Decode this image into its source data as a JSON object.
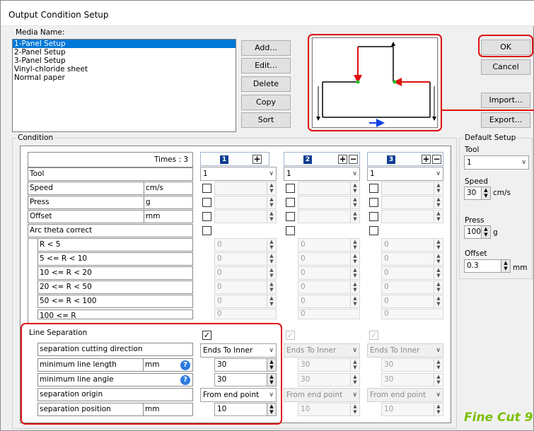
{
  "window": {
    "title": "Output Condition Setup"
  },
  "media": {
    "label": "Media Name:",
    "items": [
      "1-Panel Setup",
      "2-Panel Setup",
      "3-Panel Setup",
      "Vinyl-chloride sheet",
      "Normal paper"
    ],
    "selected_index": 0
  },
  "buttons": {
    "add": "Add...",
    "edit": "Edit...",
    "delete": "Delete",
    "copy": "Copy",
    "sort": "Sort",
    "ok": "OK",
    "cancel": "Cancel",
    "import": "Import...",
    "export": "Export..."
  },
  "condition": {
    "label": "Condition",
    "times_label": "Times : 3",
    "rows": [
      {
        "label": "Tool",
        "unit": ""
      },
      {
        "label": "Speed",
        "unit": "cm/s"
      },
      {
        "label": "Press",
        "unit": "g"
      },
      {
        "label": "Offset",
        "unit": "mm"
      },
      {
        "label": "Arc theta correct",
        "unit": ""
      },
      {
        "label": "R < 5",
        "unit": ""
      },
      {
        "label": "5 <= R < 10",
        "unit": ""
      },
      {
        "label": "10 <= R < 20",
        "unit": ""
      },
      {
        "label": "20 <= R < 50",
        "unit": ""
      },
      {
        "label": "50 <= R < 100",
        "unit": ""
      },
      {
        "label": "100 <= R",
        "unit": ""
      }
    ],
    "line_sep_rows": [
      {
        "label": "Line Separation",
        "unit": ""
      },
      {
        "label": "separation cutting direction",
        "unit": ""
      },
      {
        "label": "minimum line length",
        "unit": "mm"
      },
      {
        "label": "minimum line angle",
        "unit": ""
      },
      {
        "label": "separation origin",
        "unit": ""
      },
      {
        "label": "separation position",
        "unit": "mm"
      }
    ],
    "columns": [
      {
        "number": "1",
        "tool": "1",
        "arc_values": [
          "0",
          "0",
          "0",
          "0",
          "0",
          "0"
        ],
        "direction": "Ends To Inner",
        "min_length": "30",
        "min_angle": "30",
        "origin": "From end point",
        "position": "10"
      },
      {
        "number": "2",
        "tool": "1",
        "arc_values": [
          "0",
          "0",
          "0",
          "0",
          "0",
          "0"
        ],
        "direction": "Ends To Inner",
        "min_length": "30",
        "min_angle": "30",
        "origin": "From end point",
        "position": "10"
      },
      {
        "number": "3",
        "tool": "1",
        "arc_values": [
          "0",
          "0",
          "0",
          "0",
          "0",
          "0"
        ],
        "direction": "Ends To Inner",
        "min_length": "30",
        "min_angle": "30",
        "origin": "From end point",
        "position": "10"
      }
    ]
  },
  "default_setup": {
    "label": "Default Setup",
    "tool_label": "Tool",
    "tool_value": "1",
    "speed_label": "Speed",
    "speed_value": "30",
    "speed_unit": "cm/s",
    "press_label": "Press",
    "press_value": "100",
    "press_unit": "g",
    "offset_label": "Offset",
    "offset_value": "0.3",
    "offset_unit": "mm"
  },
  "logo": {
    "text": "Fine Cut 9"
  },
  "colors": {
    "highlight_red": "#e01010",
    "selection_blue": "#0078d7",
    "logo_green": "#7cc000"
  }
}
